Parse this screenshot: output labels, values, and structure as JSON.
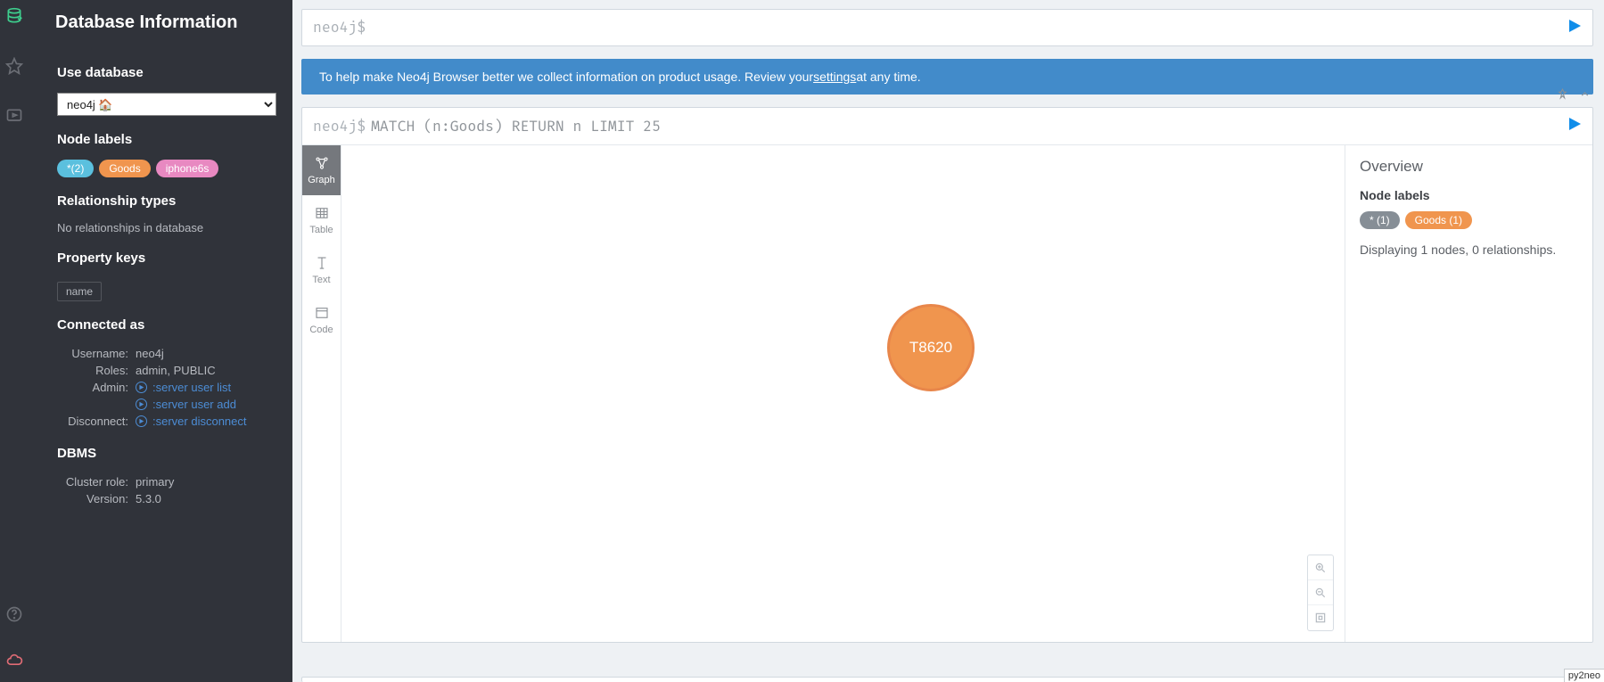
{
  "sidebar": {
    "title": "Database Information",
    "use_db_label": "Use database",
    "db_selected": "neo4j 🏠",
    "node_labels_label": "Node labels",
    "node_labels": [
      {
        "text": "*(2)",
        "cls": "teal"
      },
      {
        "text": "Goods",
        "cls": "orange"
      },
      {
        "text": "iphone6s",
        "cls": "pink"
      }
    ],
    "rel_types_label": "Relationship types",
    "rel_types_note": "No relationships in database",
    "prop_keys_label": "Property keys",
    "prop_keys": [
      "name"
    ],
    "connected_as_label": "Connected as",
    "connected": {
      "username_k": "Username:",
      "username_v": "neo4j",
      "roles_k": "Roles:",
      "roles_v": "admin, PUBLIC",
      "admin_k": "Admin:",
      "admin_links": [
        ":server user list",
        ":server user add"
      ],
      "disconnect_k": "Disconnect:",
      "disconnect_link": ":server disconnect"
    },
    "dbms_label": "DBMS",
    "dbms": {
      "cluster_k": "Cluster role:",
      "cluster_v": "primary",
      "version_k": "Version:",
      "version_v": "5.3.0"
    }
  },
  "editor": {
    "prompt": "neo4j$",
    "value": ""
  },
  "banner": {
    "before": "To help make Neo4j Browser better we collect information on product usage. Review your ",
    "link": "settings",
    "after": " at any time."
  },
  "result": {
    "prompt": "neo4j$",
    "query": "MATCH (n:Goods) RETURN n LIMIT 25",
    "tabs": {
      "graph": "Graph",
      "table": "Table",
      "text": "Text",
      "code": "Code"
    },
    "node_label": "T8620"
  },
  "overview": {
    "title": "Overview",
    "node_labels_label": "Node labels",
    "labels": [
      {
        "text": "* (1)",
        "cls": "grey"
      },
      {
        "text": "Goods (1)",
        "cls": "orange"
      }
    ],
    "summary": "Displaying 1 nodes, 0 relationships."
  },
  "corner": "py2neo"
}
